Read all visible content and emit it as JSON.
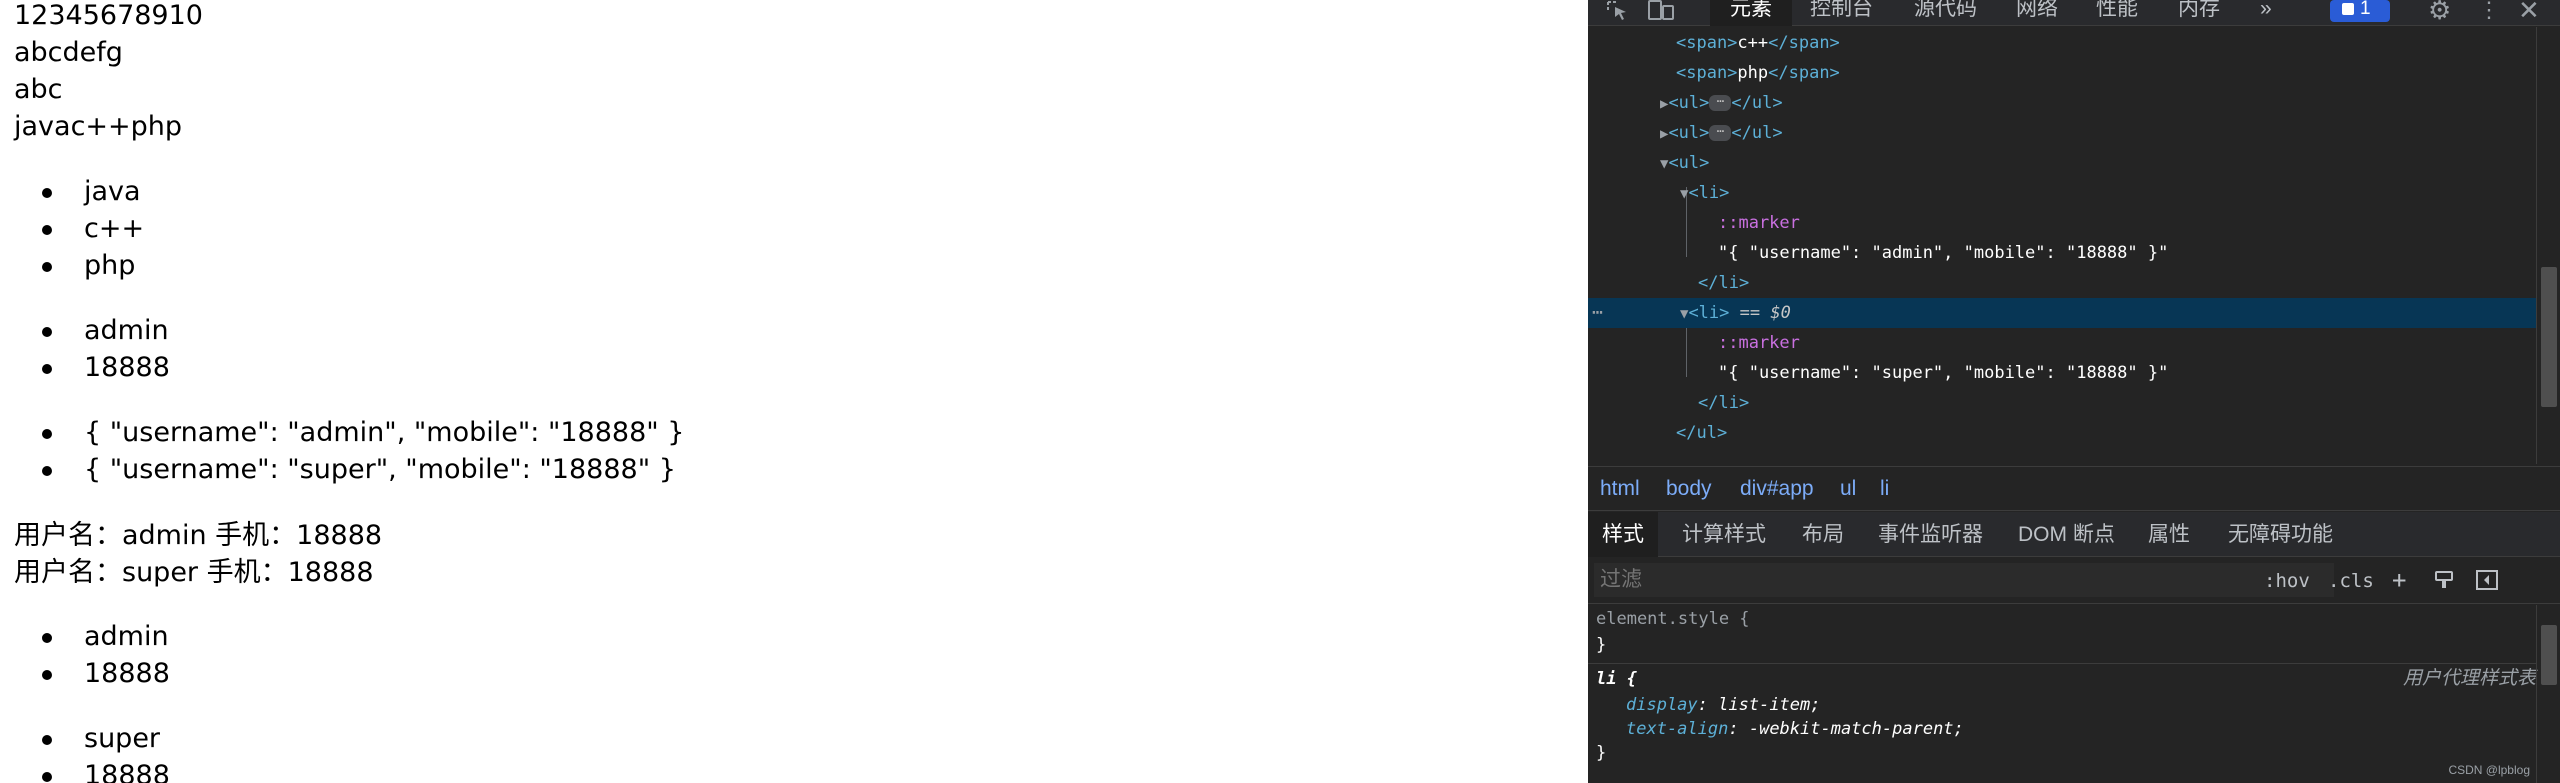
{
  "page": {
    "lines": [
      "12345678910",
      "abcdefg",
      "abc",
      "javac++php"
    ],
    "list1": [
      "java",
      "c++",
      "php"
    ],
    "list2": [
      "admin",
      "18888"
    ],
    "list3": [
      "{ \"username\": \"admin\", \"mobile\": \"18888\" }",
      "{ \"username\": \"super\", \"mobile\": \"18888\" }"
    ],
    "users": [
      "用户名：admin 手机：18888",
      "用户名：super 手机：18888"
    ],
    "list4": [
      "admin",
      "18888"
    ],
    "list5": [
      "super",
      "18888"
    ]
  },
  "devtools": {
    "tabs": [
      "元素",
      "控制台",
      "源代码",
      "网络",
      "性能",
      "内存"
    ],
    "more": "»",
    "badge": "1",
    "dom": {
      "span_cpp": "c++",
      "span_php": "php",
      "marker": "::marker",
      "li1_text": "\"{ \"username\": \"admin\", \"mobile\": \"18888\" }\"",
      "li2_text": "\"{ \"username\": \"super\", \"mobile\": \"18888\" }\"",
      "eq": "== $0"
    },
    "breadcrumbs": [
      "html",
      "body",
      "div#app",
      "ul",
      "li"
    ],
    "subtabs": [
      "样式",
      "计算样式",
      "布局",
      "事件监听器",
      "DOM 断点",
      "属性",
      "无障碍功能"
    ],
    "filter_placeholder": "过滤",
    "hov": ":hov",
    "cls": ".cls",
    "styles": {
      "element_style": "element.style {",
      "close": "}",
      "li_selector": "li {",
      "ua_label": "用户代理样式表",
      "props": [
        {
          "name": "display",
          "value": "list-item;"
        },
        {
          "name": "text-align",
          "value": "-webkit-match-parent;"
        }
      ]
    },
    "watermark": "CSDN @lpblog"
  }
}
